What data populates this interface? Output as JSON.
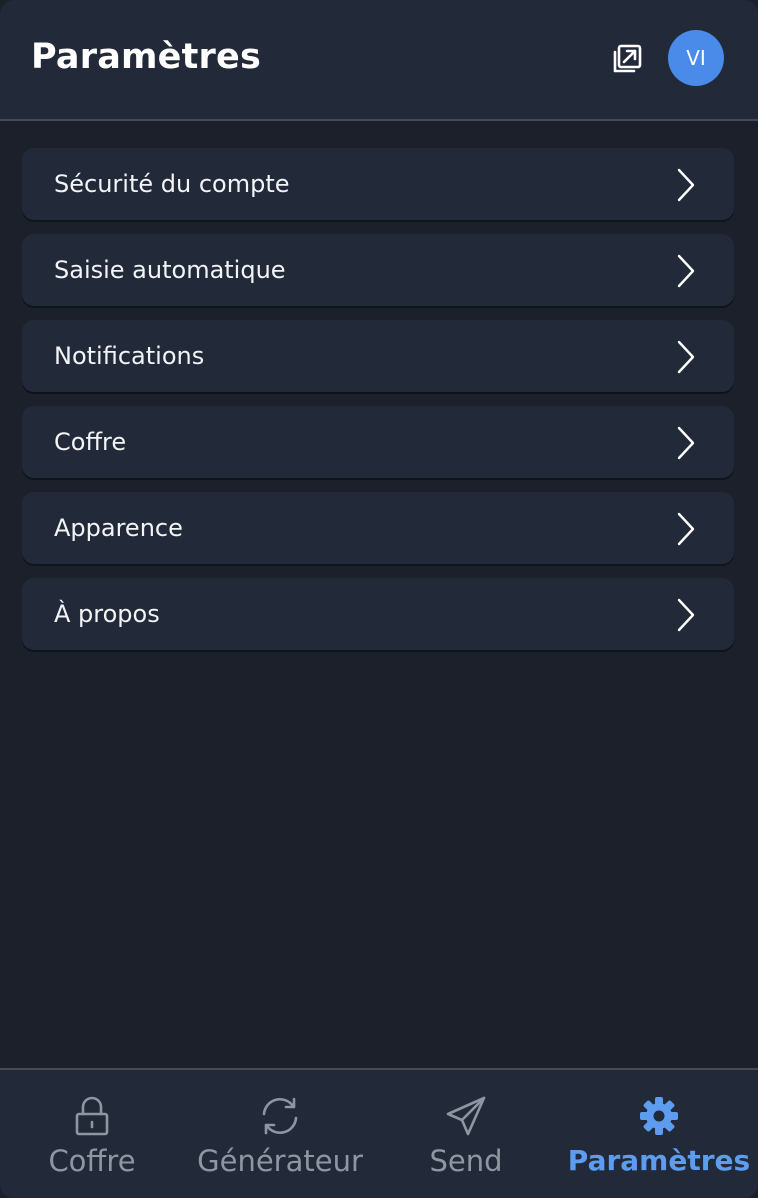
{
  "header": {
    "title": "Paramètres",
    "popout_icon": "popout-icon",
    "avatar_initials": "VI"
  },
  "menu": {
    "items": [
      {
        "label": "Sécurité du compte"
      },
      {
        "label": "Saisie automatique"
      },
      {
        "label": "Notifications"
      },
      {
        "label": "Coffre"
      },
      {
        "label": "Apparence"
      },
      {
        "label": "À propos"
      }
    ]
  },
  "bottom_nav": {
    "tabs": [
      {
        "label": "Coffre",
        "icon": "lock-icon",
        "active": false
      },
      {
        "label": "Générateur",
        "icon": "refresh-icon",
        "active": false
      },
      {
        "label": "Send",
        "icon": "paper-plane-icon",
        "active": false
      },
      {
        "label": "Paramètres",
        "icon": "gear-icon",
        "active": true
      }
    ]
  },
  "colors": {
    "background": "#1b202b",
    "surface": "#222938",
    "accent": "#5e9cf0",
    "avatar": "#4a8ae8",
    "inactive_text": "#8f96a2"
  }
}
